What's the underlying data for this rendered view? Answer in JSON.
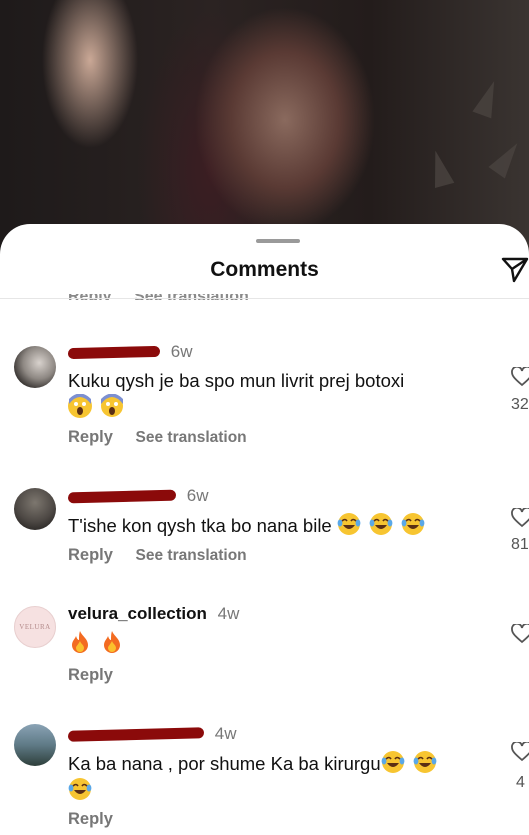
{
  "sheet": {
    "title": "Comments",
    "ghost_reply": "Reply",
    "ghost_translation": "See translation"
  },
  "comments": [
    {
      "time": "6w",
      "text": "Kuku qysh je ba spo mun livrit prej botoxi",
      "emoji": [
        "face-screaming-in-fear",
        "face-screaming-in-fear"
      ],
      "reply": "Reply",
      "translate": "See translation",
      "like_count": "32"
    },
    {
      "time": "6w",
      "text": "T'ishe kon qysh tka bo nana bile",
      "emoji": [
        "face-with-tears-of-joy",
        "face-with-tears-of-joy",
        "face-with-tears-of-joy"
      ],
      "reply": "Reply",
      "translate": "See translation",
      "like_count": "81"
    },
    {
      "username": "velura_collection",
      "avatar_text": "VELURA",
      "time": "4w",
      "emoji": [
        "fire",
        "fire"
      ],
      "reply": "Reply"
    },
    {
      "time": "4w",
      "text": "Ka ba nana , por shume Ka ba kirurgu",
      "emoji": [
        "face-with-tears-of-joy",
        "face-with-tears-of-joy",
        "face-with-tears-of-joy"
      ],
      "reply": "Reply",
      "like_count": "4"
    }
  ],
  "colors": {
    "redaction": "#8b0a0a",
    "muted_text": "#777777",
    "emoji_yellow": "#f7c531",
    "fire_orange": "#f36b21"
  }
}
